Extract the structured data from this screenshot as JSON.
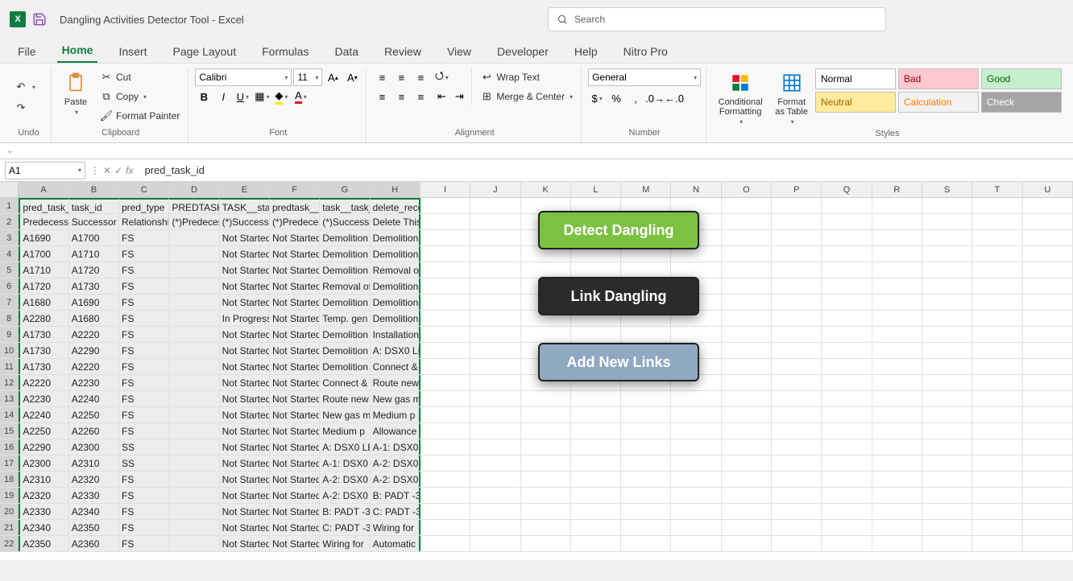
{
  "app": {
    "title": "Dangling Activities Detector Tool  -  Excel"
  },
  "search": {
    "placeholder": "Search"
  },
  "tabs": [
    "File",
    "Home",
    "Insert",
    "Page Layout",
    "Formulas",
    "Data",
    "Review",
    "View",
    "Developer",
    "Help",
    "Nitro Pro"
  ],
  "ribbon": {
    "undo_label": "Undo",
    "clipboard": {
      "paste": "Paste",
      "cut": "Cut",
      "copy": "Copy",
      "painter": "Format Painter",
      "label": "Clipboard"
    },
    "font": {
      "name": "Calibri",
      "size": "11",
      "label": "Font"
    },
    "alignment": {
      "wrap": "Wrap Text",
      "merge": "Merge & Center",
      "label": "Alignment"
    },
    "number": {
      "format": "General",
      "label": "Number"
    },
    "styles": {
      "cond": "Conditional Formatting",
      "table": "Format as Table",
      "label": "Styles",
      "cells": [
        "Normal",
        "Bad",
        "Good",
        "Neutral",
        "Calculation",
        "Check"
      ]
    }
  },
  "namebox": "A1",
  "formula": "pred_task_id",
  "columns": [
    "A",
    "B",
    "C",
    "D",
    "E",
    "F",
    "G",
    "H",
    "I",
    "J",
    "K",
    "L",
    "M",
    "N",
    "O",
    "P",
    "Q",
    "R",
    "S",
    "T",
    "U"
  ],
  "rows": [
    [
      "pred_task_id",
      "task_id",
      "pred_type",
      "PREDTASK__status_code",
      "TASK__status_code",
      "predtask__task_name",
      "task__task_name",
      "delete_record_flag"
    ],
    [
      "Predecessor",
      "Successor",
      "Relationship",
      "(*)Predecessor",
      "(*)Successor",
      "(*)Predecessor",
      "(*)Successor",
      "Delete This Row"
    ],
    [
      "A1690",
      "A1700",
      "FS",
      "",
      "Not Started",
      "Not Started",
      "Demolition",
      "Demolition"
    ],
    [
      "A1700",
      "A1710",
      "FS",
      "",
      "Not Started",
      "Not Started",
      "Demolition",
      "Demolition"
    ],
    [
      "A1710",
      "A1720",
      "FS",
      "",
      "Not Started",
      "Not Started",
      "Demolition",
      "Removal of"
    ],
    [
      "A1720",
      "A1730",
      "FS",
      "",
      "Not Started",
      "Not Started",
      "Removal of",
      "Demolition"
    ],
    [
      "A1680",
      "A1690",
      "FS",
      "",
      "Not Started",
      "Not Started",
      "Demolition",
      "Demolition"
    ],
    [
      "A2280",
      "A1680",
      "FS",
      "",
      "In Progress",
      "Not Started",
      "Temp. gen",
      "Demolition"
    ],
    [
      "A1730",
      "A2220",
      "FS",
      "",
      "Not Started",
      "Not Started",
      "Demolition",
      "Installation"
    ],
    [
      "A1730",
      "A2290",
      "FS",
      "",
      "Not Started",
      "Not Started",
      "Demolition",
      "A: DSX0 LE"
    ],
    [
      "A1730",
      "A2220",
      "FS",
      "",
      "Not Started",
      "Not Started",
      "Demolition",
      "Connect &"
    ],
    [
      "A2220",
      "A2230",
      "FS",
      "",
      "Not Started",
      "Not Started",
      "Connect &",
      "Route new"
    ],
    [
      "A2230",
      "A2240",
      "FS",
      "",
      "Not Started",
      "Not Started",
      "Route new",
      "New gas m"
    ],
    [
      "A2240",
      "A2250",
      "FS",
      "",
      "Not Started",
      "Not Started",
      "New gas m",
      "Medium p"
    ],
    [
      "A2250",
      "A2260",
      "FS",
      "",
      "Not Started",
      "Not Started",
      "Medium p",
      "Allowance"
    ],
    [
      "A2290",
      "A2300",
      "SS",
      "",
      "Not Started",
      "Not Started",
      "A: DSX0 LE",
      "A-1: DSX0"
    ],
    [
      "A2300",
      "A2310",
      "SS",
      "",
      "Not Started",
      "Not Started",
      "A-1: DSX0",
      "A-2: DSX0"
    ],
    [
      "A2310",
      "A2320",
      "FS",
      "",
      "Not Started",
      "Not Started",
      "A-2: DSX0",
      "A-2: DSX0"
    ],
    [
      "A2320",
      "A2330",
      "FS",
      "",
      "Not Started",
      "Not Started",
      "A-2: DSX0",
      "B: PADT -3"
    ],
    [
      "A2330",
      "A2340",
      "FS",
      "",
      "Not Started",
      "Not Started",
      "B: PADT -3",
      "C: PADT -3"
    ],
    [
      "A2340",
      "A2350",
      "FS",
      "",
      "Not Started",
      "Not Started",
      "C: PADT -3",
      "Wiring for"
    ],
    [
      "A2350",
      "A2360",
      "FS",
      "",
      "Not Started",
      "Not Started",
      "Wiring for",
      "Automatic"
    ]
  ],
  "embed_buttons": {
    "detect": "Detect Dangling",
    "link": "Link Dangling",
    "add": "Add New Links"
  }
}
